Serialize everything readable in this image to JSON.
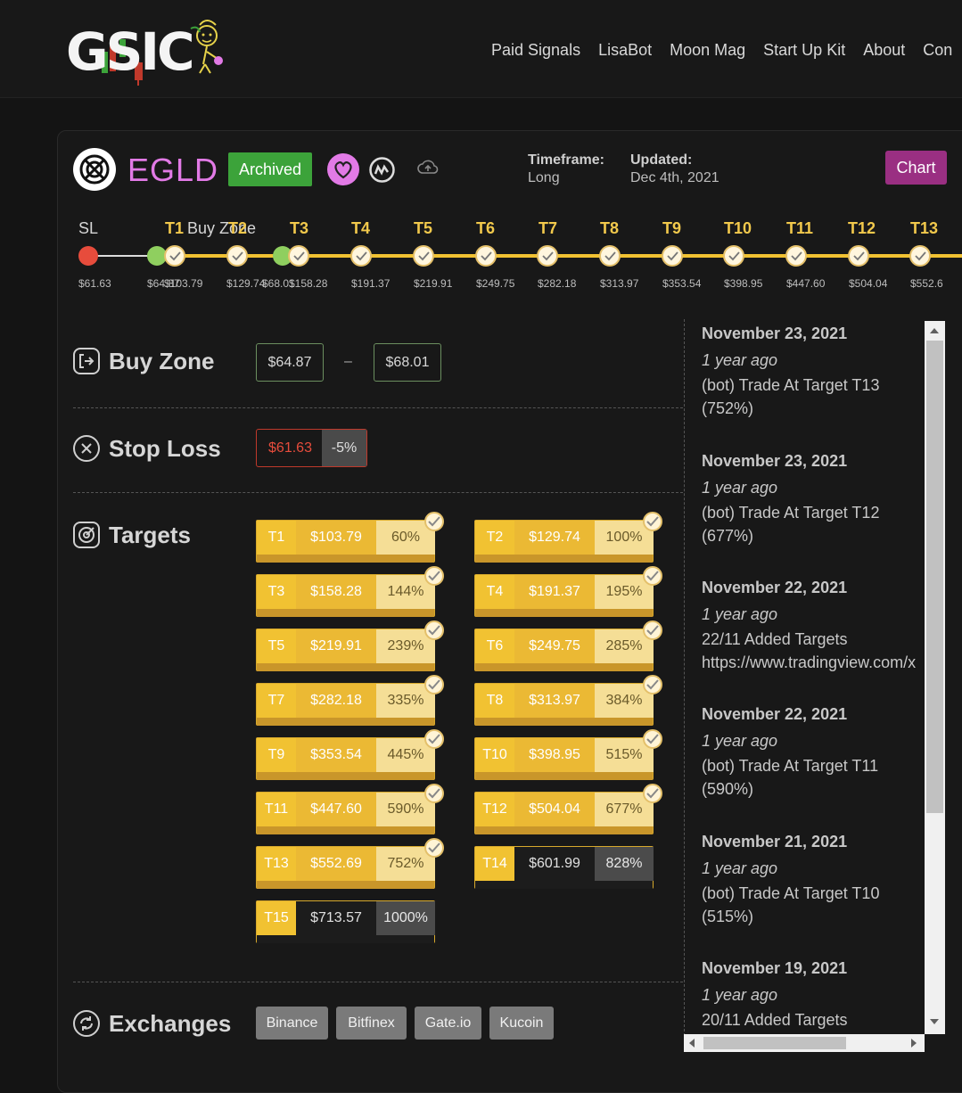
{
  "header": {
    "logo_text": "GSIC",
    "nav": [
      "Paid Signals",
      "LisaBot",
      "Moon Mag",
      "Start Up Kit",
      "About",
      "Con"
    ]
  },
  "coin": {
    "name": "EGLD",
    "status": "Archived",
    "timeframe_label": "Timeframe:",
    "timeframe_value": "Long",
    "updated_label": "Updated:",
    "updated_value": "Dec 4th, 2021",
    "chart_button": "Chart"
  },
  "track": {
    "labels": [
      {
        "text": "SL",
        "cls": "sl"
      },
      {
        "text": "T1",
        "cls": "t"
      },
      {
        "text": "Buy Zone",
        "cls": "bz"
      },
      {
        "text": "T2",
        "cls": "t"
      },
      {
        "text": "T3",
        "cls": "t"
      },
      {
        "text": "T4",
        "cls": "t"
      },
      {
        "text": "T5",
        "cls": "t"
      },
      {
        "text": "T6",
        "cls": "t"
      },
      {
        "text": "T7",
        "cls": "t"
      },
      {
        "text": "T8",
        "cls": "t"
      },
      {
        "text": "T9",
        "cls": "t"
      },
      {
        "text": "T10",
        "cls": "t"
      },
      {
        "text": "T11",
        "cls": "t"
      },
      {
        "text": "T12",
        "cls": "t"
      },
      {
        "text": "T13",
        "cls": "t"
      }
    ],
    "prices": [
      "$61.63",
      "$64.87",
      "$103.79",
      "$129.74",
      "$68.01",
      "$158.28",
      "$191.37",
      "$219.91",
      "$249.75",
      "$282.18",
      "$313.97",
      "$353.54",
      "$398.95",
      "$447.60",
      "$504.04",
      "$552.6"
    ]
  },
  "buy_zone": {
    "title": "Buy Zone",
    "low": "$64.87",
    "separator": "–",
    "high": "$68.01"
  },
  "stop_loss": {
    "title": "Stop Loss",
    "value": "$61.63",
    "percent": "-5%"
  },
  "targets": {
    "title": "Targets",
    "items": [
      {
        "name": "T1",
        "price": "$103.79",
        "pct": "60%",
        "hit": true
      },
      {
        "name": "T2",
        "price": "$129.74",
        "pct": "100%",
        "hit": true
      },
      {
        "name": "T3",
        "price": "$158.28",
        "pct": "144%",
        "hit": true
      },
      {
        "name": "T4",
        "price": "$191.37",
        "pct": "195%",
        "hit": true
      },
      {
        "name": "T5",
        "price": "$219.91",
        "pct": "239%",
        "hit": true
      },
      {
        "name": "T6",
        "price": "$249.75",
        "pct": "285%",
        "hit": true
      },
      {
        "name": "T7",
        "price": "$282.18",
        "pct": "335%",
        "hit": true
      },
      {
        "name": "T8",
        "price": "$313.97",
        "pct": "384%",
        "hit": true
      },
      {
        "name": "T9",
        "price": "$353.54",
        "pct": "445%",
        "hit": true
      },
      {
        "name": "T10",
        "price": "$398.95",
        "pct": "515%",
        "hit": true
      },
      {
        "name": "T11",
        "price": "$447.60",
        "pct": "590%",
        "hit": true
      },
      {
        "name": "T12",
        "price": "$504.04",
        "pct": "677%",
        "hit": true
      },
      {
        "name": "T13",
        "price": "$552.69",
        "pct": "752%",
        "hit": true
      },
      {
        "name": "T14",
        "price": "$601.99",
        "pct": "828%",
        "hit": false
      },
      {
        "name": "T15",
        "price": "$713.57",
        "pct": "1000%",
        "hit": false
      }
    ]
  },
  "exchanges": {
    "title": "Exchanges",
    "items": [
      "Binance",
      "Bitfinex",
      "Gate.io",
      "Kucoin"
    ]
  },
  "feed": [
    {
      "date": "November 23, 2021",
      "ago": "1 year ago",
      "text": "(bot) Trade At Target T13\n(752%)"
    },
    {
      "date": "November 23, 2021",
      "ago": "1 year ago",
      "text": "(bot) Trade At Target T12\n(677%)"
    },
    {
      "date": "November 22, 2021",
      "ago": "1 year ago",
      "text": "22/11 Added Targets\nhttps://www.tradingview.com/x"
    },
    {
      "date": "November 22, 2021",
      "ago": "1 year ago",
      "text": "(bot) Trade At Target T11\n(590%)"
    },
    {
      "date": "November 21, 2021",
      "ago": "1 year ago",
      "text": "(bot) Trade At Target T10\n(515%)"
    },
    {
      "date": "November 19, 2021",
      "ago": "1 year ago",
      "text": "20/11 Added Targets"
    }
  ],
  "colors": {
    "accent_pink": "#e27ae6",
    "archived_green": "#3ca33a",
    "target_gold": "#f1c232",
    "stop_red": "#e74c3c",
    "chart_purple": "#9a2f82"
  }
}
